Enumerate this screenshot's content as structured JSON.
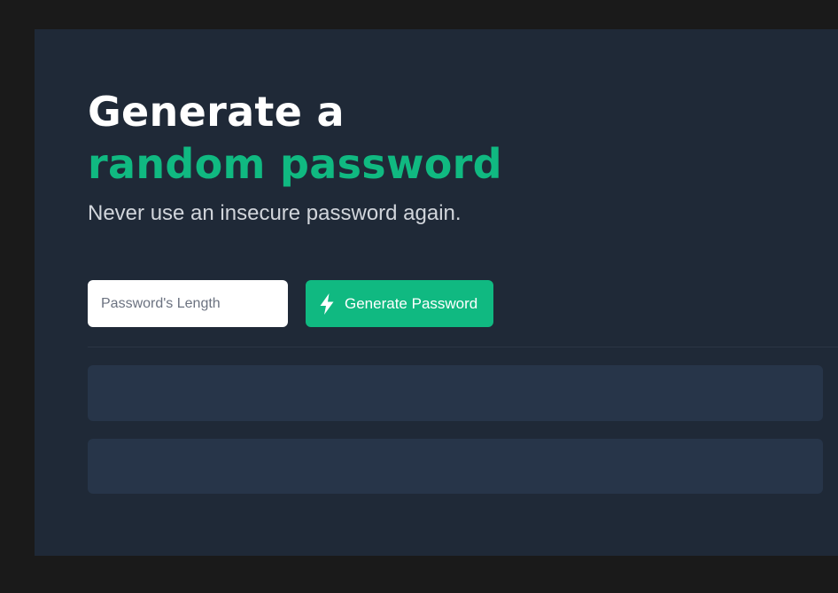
{
  "header": {
    "title_line1": "Generate a",
    "title_line2": "random password",
    "subtitle": "Never use an insecure password again."
  },
  "form": {
    "length_input": {
      "placeholder": "Password's Length",
      "value": ""
    },
    "generate_button": {
      "label": "Generate Password",
      "icon": "lightning-bolt-icon"
    }
  },
  "results": {
    "password_1": "",
    "password_2": ""
  },
  "colors": {
    "background": "#1a1a1a",
    "card": "#1f2937",
    "accent": "#10b981",
    "result_box": "#273549",
    "subtitle_text": "#d1d5db"
  }
}
